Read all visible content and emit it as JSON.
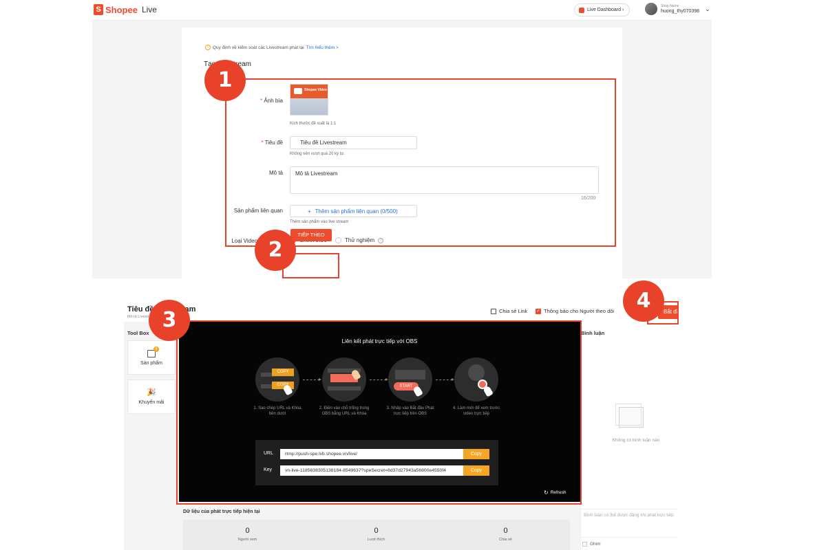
{
  "form_page": {
    "brand": {
      "logo_glyph": "S",
      "name": "Shopee",
      "product": "Live"
    },
    "dashboard_button": "Live Dashboard ›",
    "user": {
      "shop_label": "Shop Name",
      "username": "huong_thy070398"
    },
    "notice": {
      "text": "Quy định về kiểm soát các Livestream phát lại",
      "link": "Tìm hiểu thêm >"
    },
    "title": "Tạo Livestream",
    "fields": {
      "cover": {
        "label": "Ảnh bìa",
        "hint": "Kích thước đề xuất là 1:1",
        "thumb_text": "Shopee Video"
      },
      "title": {
        "label": "Tiêu đề",
        "value": "Tiêu đề Livestream",
        "hint": "Không nên vượt quá 20 ký tự."
      },
      "description": {
        "label": "Mô tả",
        "value": "Mô tả Livestream",
        "counter": "16/200"
      },
      "products": {
        "label": "Sản phẩm liên quan",
        "button": "Thêm sản phẩm liên quan (0/500)",
        "hint": "Thêm sản phẩm vào live stream"
      },
      "video_type": {
        "label": "Loại Video",
        "options": [
          "Chính thức",
          "Thử nghiệm"
        ],
        "selected": "Chính thức"
      }
    },
    "next_button": "TIẾP THEO"
  },
  "stream_page": {
    "title": "Tiêu đề Livestream",
    "description": "Mô tả Livestream",
    "share_link": "Chia sẻ Link",
    "follower_notify": "Thông báo cho Người theo dõi",
    "start_button": "Bắt đầu",
    "toolbox": {
      "title": "Tool Box",
      "items": [
        {
          "label": "Sản phẩm",
          "badge": "0"
        },
        {
          "label": "Khuyến mãi"
        }
      ]
    },
    "obs": {
      "title": "Liên kết phát trực tiếp với OBS",
      "steps": [
        {
          "caption": "1. Sao chép URL và Khóa bên dưới",
          "chips": [
            "COPY",
            "COPY"
          ]
        },
        {
          "caption": "2. Điền vào chỗ trống trong OBS bằng URL và Khóa"
        },
        {
          "caption": "3. Nhấp vào Bắt đầu Phát trực tiếp trên OBS",
          "chip": "START"
        },
        {
          "caption": "4. Làm mới để xem trước video trực tiếp"
        }
      ],
      "url_label": "URL",
      "url_value": "rtmp://push-spe.lvb.shopee.vn/live/",
      "key_label": "Key",
      "key_value": "vn-live-1185638305138184-8549637?speSecret=8d37d27943a56800e4550f4",
      "copy_label": "Copy",
      "refresh": "Refresh"
    },
    "stats": {
      "title": "Dữ liệu của phát trực tiếp hiện tại",
      "items": [
        {
          "value": "0",
          "label": "Người xem"
        },
        {
          "value": "0",
          "label": "Lượt thích"
        },
        {
          "value": "0",
          "label": "Chia sẻ"
        }
      ]
    },
    "comments": {
      "title": "Bình luận",
      "empty": "Không có bình luận nào",
      "placeholder": "Bình luận có thể được đăng khi phát trực tiếp",
      "pin": "Ghim"
    }
  },
  "annotations": [
    "1",
    "2",
    "3",
    "4"
  ],
  "colors": {
    "accent": "#ee4d2d",
    "highlight": "#e8432a",
    "copy": "#f5a623",
    "obs_bg": "#050505"
  }
}
